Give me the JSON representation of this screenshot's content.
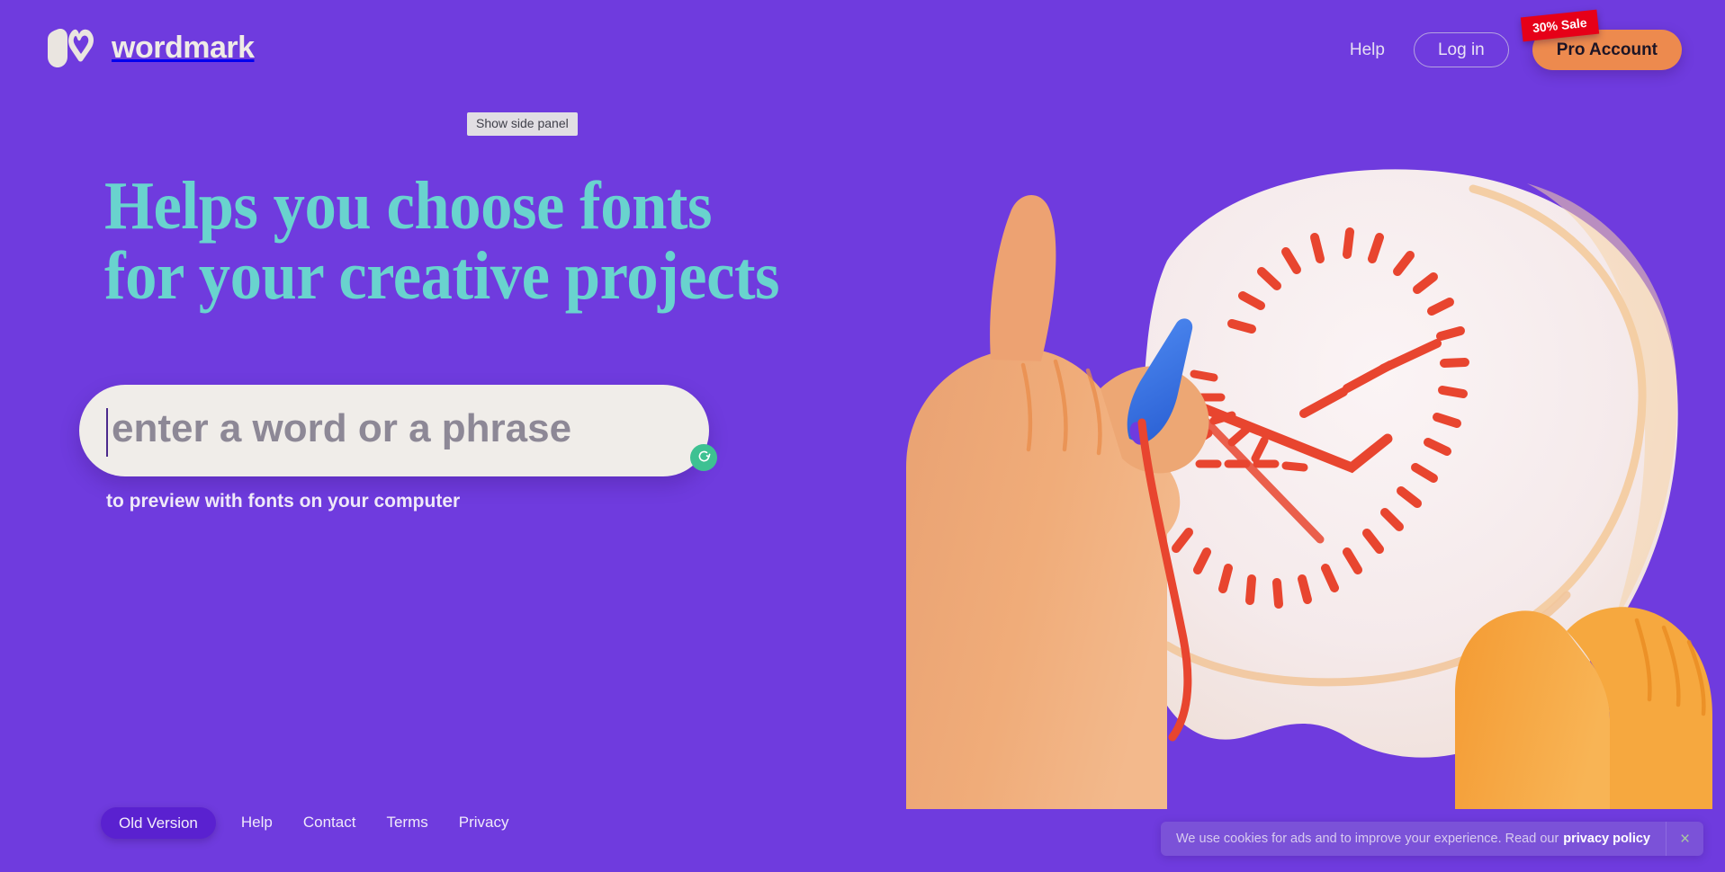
{
  "page": {
    "background_color": "#6F3BDE",
    "accent_teal": "#69D3CE",
    "accent_orange": "#ED8A4E",
    "accent_red": "#E60018",
    "accent_green": "#3EC192"
  },
  "header": {
    "brand_name": "wordmark",
    "logo_icon": "heart-w-logo-icon",
    "nav": {
      "help_label": "Help",
      "login_label": "Log in",
      "pro_label": "Pro Account",
      "sale_badge": "30% Sale"
    }
  },
  "side_panel": {
    "toggle_label": "Show side panel"
  },
  "hero": {
    "title": "Helps you choose fonts\nfor your creative projects"
  },
  "search": {
    "placeholder": "enter a word or a phrase",
    "value": "",
    "refresh_icon": "refresh-icon",
    "subtitle": "to preview with fonts on your computer"
  },
  "illustration": {
    "name": "hands-embroidering-heart-illustration",
    "fabric_color": "#F6EDEE",
    "hoop_color": "#F2C89C",
    "skin_color": "#EFA671",
    "skin_color_dark": "#F2992F",
    "needle_color": "#3C77E8",
    "thread_color": "#E8392C"
  },
  "footer": {
    "old_version_label": "Old Version",
    "links": [
      {
        "label": "Help"
      },
      {
        "label": "Contact"
      },
      {
        "label": "Terms"
      },
      {
        "label": "Privacy"
      }
    ]
  },
  "cookie_bar": {
    "message": "We use cookies for ads and to improve your experience. Read our",
    "policy_label": "privacy policy",
    "close_icon": "close-icon",
    "close_label": "×"
  }
}
